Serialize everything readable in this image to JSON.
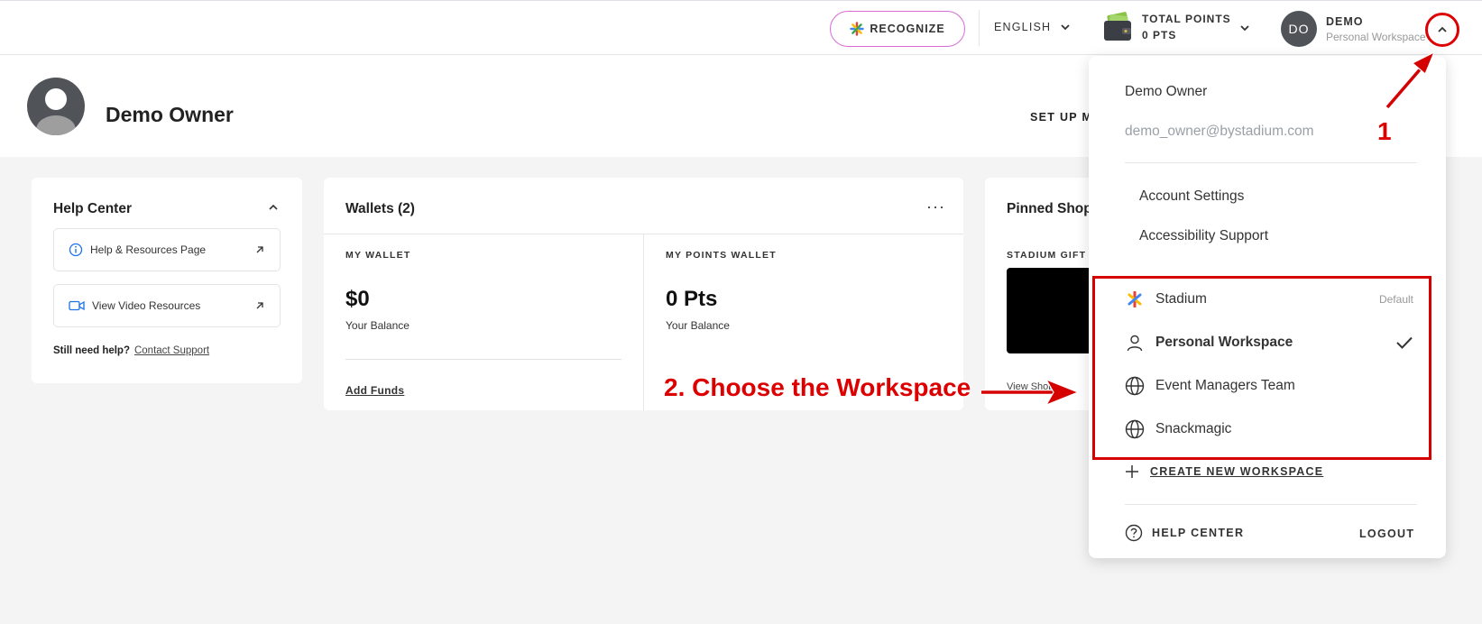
{
  "topbar": {
    "recognize_label": "RECOGNIZE",
    "language": "ENGLISH",
    "points_label": "TOTAL POINTS",
    "points_value": "0 PTS",
    "user_initials": "DO",
    "user_name": "DEMO",
    "user_workspace": "Personal Workspace"
  },
  "profile": {
    "name": "Demo Owner",
    "setup_link": "SET UP MY"
  },
  "help_center": {
    "title": "Help Center",
    "items": [
      {
        "label": "Help & Resources Page"
      },
      {
        "label": "View Video Resources"
      }
    ],
    "still_need_help": "Still need help?",
    "contact_link": "Contact Support"
  },
  "wallets": {
    "title": "Wallets (2)",
    "more": "···",
    "my_wallet": {
      "label": "MY WALLET",
      "amount": "$0",
      "sub": "Your Balance",
      "action": "Add Funds"
    },
    "points_wallet": {
      "label": "MY POINTS WALLET",
      "amount": "0 Pts",
      "sub": "Your Balance"
    }
  },
  "pinned": {
    "title": "Pinned Shop",
    "subtitle": "STADIUM GIFT SHOP",
    "view": "View Shop"
  },
  "dropdown": {
    "name": "Demo Owner",
    "email": "demo_owner@bystadium.com",
    "links": [
      "Account Settings",
      "Accessibility Support"
    ],
    "workspaces": [
      {
        "label": "Stadium",
        "badge": "Default",
        "icon": "stadium-logo-icon"
      },
      {
        "label": "Personal Workspace",
        "badge": "",
        "icon": "person-icon",
        "active": true
      },
      {
        "label": "Event Managers Team",
        "badge": "",
        "icon": "globe-icon"
      },
      {
        "label": "Snackmagic",
        "badge": "",
        "icon": "globe-icon"
      }
    ],
    "create_label": "CREATE NEW WORKSPACE",
    "help_label": "HELP CENTER",
    "logout_label": "LOGOUT"
  },
  "annotations": {
    "step1": "1",
    "step2": "2. Choose the Workspace",
    "color": "#d50000"
  }
}
